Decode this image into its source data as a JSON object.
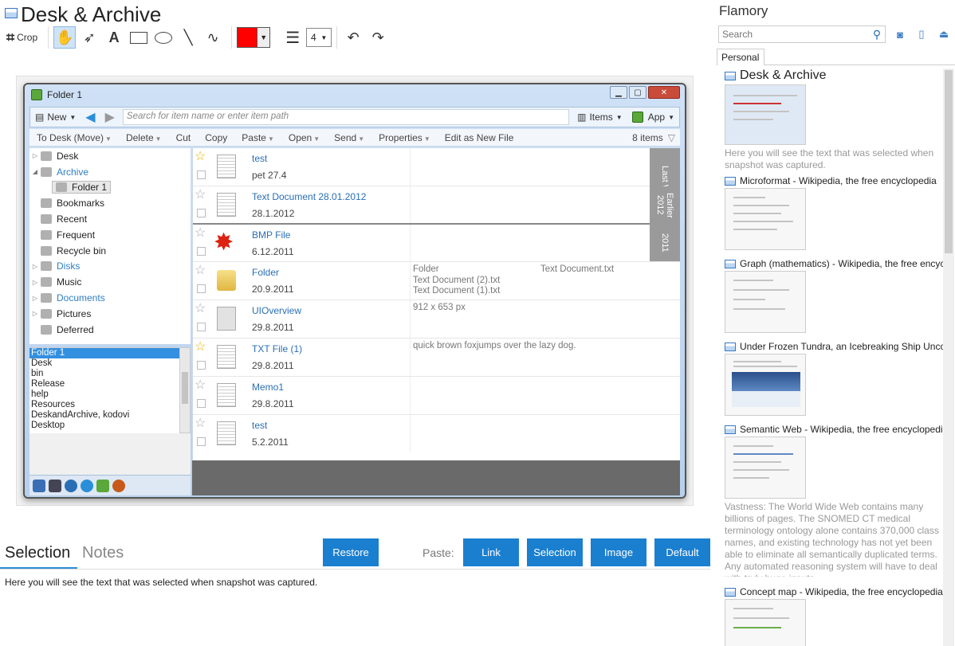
{
  "title": "Desk & Archive",
  "toolbar": {
    "crop_label": "Crop",
    "line_width": "4",
    "color": "#ff0000"
  },
  "window": {
    "title": "Folder 1",
    "new_label": "New",
    "search_placeholder": "Search for item name or enter item path",
    "items_label": "Items",
    "app_label": "App",
    "commands": [
      "To Desk (Move)",
      "Delete",
      "Cut",
      "Copy",
      "Paste",
      "Open",
      "Send",
      "Properties",
      "Edit as New File"
    ],
    "count": "8 items",
    "tree": [
      {
        "label": "Desk",
        "icon": "pen-icon"
      },
      {
        "label": "Archive",
        "icon": "archive-icon"
      },
      {
        "label": "Folder 1",
        "icon": "folder-icon"
      },
      {
        "label": "Bookmarks",
        "icon": "star-icon"
      },
      {
        "label": "Recent",
        "icon": "clock-icon"
      },
      {
        "label": "Frequent",
        "icon": "bars-icon"
      },
      {
        "label": "Recycle bin",
        "icon": "bin-icon"
      },
      {
        "label": "Disks",
        "icon": "disk-icon"
      },
      {
        "label": "Music",
        "icon": "library-icon"
      },
      {
        "label": "Documents",
        "icon": "library-icon"
      },
      {
        "label": "Pictures",
        "icon": "library-icon"
      },
      {
        "label": "Deferred",
        "icon": "library-icon"
      }
    ],
    "list": [
      "Folder 1",
      "Desk",
      "bin",
      "Release",
      "help",
      "Resources",
      "DeskandArchive, kodovi",
      "Desktop"
    ],
    "groups": [
      "Last Week",
      "Earlier 2012",
      "2011"
    ],
    "items": [
      {
        "name": "test",
        "date": "pet 27.4",
        "info": [],
        "info2": ""
      },
      {
        "name": "Text Document 28.01.2012",
        "date": "28.1.2012",
        "info": [],
        "info2": ""
      },
      {
        "name": "BMP File",
        "date": "6.12.2011",
        "info": [],
        "info2": ""
      },
      {
        "name": "Folder",
        "date": "20.9.2011",
        "info": [
          "Folder",
          "Text Document (2).txt",
          "Text Document (1).txt"
        ],
        "info2": "Text Document.txt"
      },
      {
        "name": "UIOverview",
        "date": "29.8.2011",
        "info": [
          "912 x 653 px"
        ],
        "info2": ""
      },
      {
        "name": "TXT File (1)",
        "date": "29.8.2011",
        "info": [
          "quick brown foxjumps over the lazy dog."
        ],
        "info2": ""
      },
      {
        "name": "Memo1",
        "date": "29.8.2011",
        "info": [],
        "info2": ""
      },
      {
        "name": "test",
        "date": "5.2.2011",
        "info": [],
        "info2": ""
      }
    ]
  },
  "bottom": {
    "tab_selection": "Selection",
    "tab_notes": "Notes",
    "restore": "Restore",
    "paste_label": "Paste:",
    "paste_buttons": [
      "Link",
      "Selection",
      "Image",
      "Default"
    ],
    "selection_text": "Here you will see the text that was selected when snapshot was captured."
  },
  "sidebar": {
    "title": "Flamory",
    "search_placeholder": "Search",
    "tab": "Personal",
    "items": [
      {
        "title": "Desk & Archive",
        "desc": "Here you will see the text that was selected when snapshot was captured."
      },
      {
        "title": "Microformat - Wikipedia, the free encyclopedia",
        "desc": ""
      },
      {
        "title": "Graph (mathematics) - Wikipedia, the free encyclopedia",
        "desc": ""
      },
      {
        "title": "Under Frozen Tundra, an Icebreaking Ship Uncovers",
        "desc": ""
      },
      {
        "title": "Semantic Web - Wikipedia, the free encyclopedia",
        "desc": "Vastness: The World Wide Web contains many billions of pages. The SNOMED CT medical terminology ontology alone contains 370,000 class names, and existing technology has not yet been able to eliminate all semantically duplicated terms. Any automated reasoning system will have to deal with truly huge inputs."
      },
      {
        "title": "Concept map - Wikipedia, the free encyclopedia",
        "desc": ""
      }
    ]
  },
  "colors": {
    "accent": "#1b7fd0",
    "link": "#2a6fb5"
  }
}
